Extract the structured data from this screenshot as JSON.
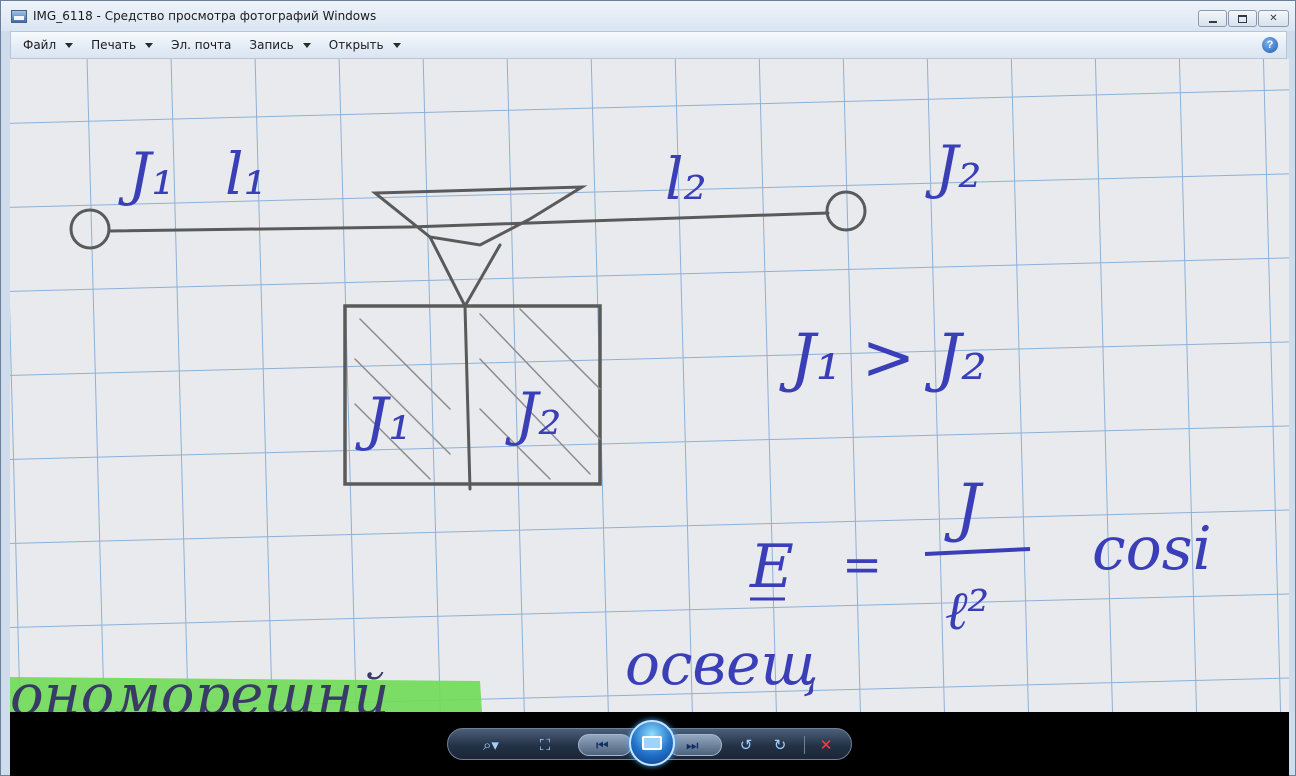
{
  "window": {
    "title": "IMG_6118 - Средство просмотра фотографий Windows",
    "controls": {
      "minimize": "▭",
      "restore": "🗗",
      "close": "✕"
    }
  },
  "menu": {
    "items": [
      {
        "label": "Файл",
        "has_dropdown": true
      },
      {
        "label": "Печать",
        "has_dropdown": true
      },
      {
        "label": "Эл. почта",
        "has_dropdown": false
      },
      {
        "label": "Запись",
        "has_dropdown": true
      },
      {
        "label": "Открыть",
        "has_dropdown": true
      }
    ],
    "help_glyph": "?"
  },
  "photo": {
    "handwriting": {
      "label_j1_top": "J₁",
      "label_l1": "l₁",
      "label_l2": "l₂",
      "label_j2_top": "J₂",
      "label_j1_box": "J₁",
      "label_j2_box": "J₂",
      "inequality": "J₁ > J₂",
      "formula_lhs": "E",
      "formula_eq": "=",
      "formula_num": "J",
      "formula_den": "ℓ²",
      "formula_tail": "cosi",
      "word_bottom": "освещ",
      "highlighted_word": "ономорешнй"
    }
  },
  "controls": {
    "zoom_icon": "zoom-icon",
    "fit_icon": "fit-to-window-icon",
    "prev_icon": "previous-icon",
    "slideshow_icon": "slideshow-icon",
    "next_icon": "next-icon",
    "rotate_ccw_icon": "rotate-counterclockwise-icon",
    "rotate_cw_icon": "rotate-clockwise-icon",
    "delete_icon": "delete-icon"
  }
}
